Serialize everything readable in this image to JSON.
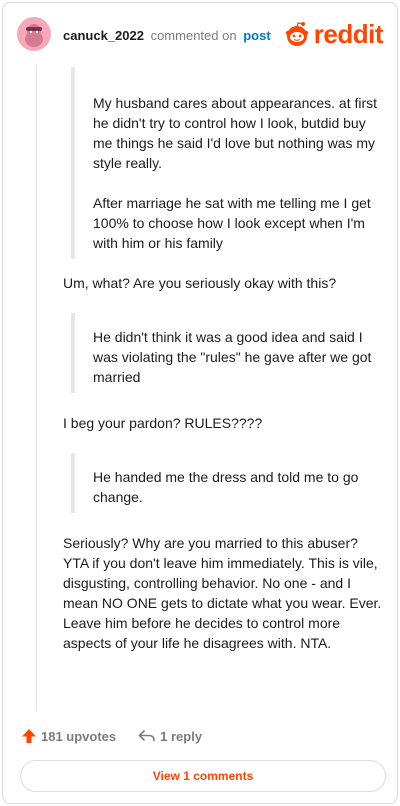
{
  "header": {
    "username": "canuck_2022",
    "action_text": "commented on",
    "post_link": "post",
    "logo_text": "reddit"
  },
  "comment": {
    "quote1": [
      "My husband cares about appearances. at first he didn't try to control how I look, butdid buy me things he said I'd love but nothing was my style really.",
      "After marriage he sat with me telling me I get 100% to choose how I look except when I'm with him or his family"
    ],
    "reply1": "Um, what? Are you seriously okay with this?",
    "quote2": "He didn't think it was a good idea and said I was violating the \"rules\" he gave after we got married",
    "reply2": "I beg your pardon? RULES????",
    "quote3": "He handed me the dress and told me to go change.",
    "reply3": "Seriously? Why are you married to this abuser? YTA if you don't leave him immediately. This is vile, disgusting, controlling behavior. No one - and I mean NO ONE gets to dictate what you wear. Ever. Leave him before he decides to control more aspects of your life he disagrees with. NTA."
  },
  "footer": {
    "upvotes": "181 upvotes",
    "replies": "1 reply",
    "view_button": "View 1 comments"
  },
  "colors": {
    "brand": "#ff4500",
    "link": "#0079d3",
    "muted": "#7c7c7c",
    "avatar_bg": "#f7a8b8"
  },
  "icons": {
    "avatar": "snoo-avatar",
    "logo": "reddit-snoo-icon",
    "upvote": "upvote-arrow-icon",
    "reply": "reply-arrow-icon"
  }
}
